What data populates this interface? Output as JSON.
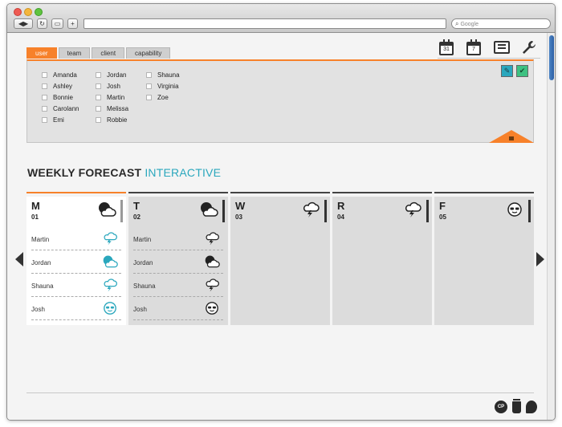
{
  "browser": {
    "search_placeholder": "Google",
    "buttons": [
      "◀",
      "▶",
      "↻",
      "+"
    ]
  },
  "top_icons": [
    {
      "name": "calendar-month-icon",
      "label": "31"
    },
    {
      "name": "calendar-week-icon",
      "label": "7"
    },
    {
      "name": "list-icon",
      "label": ""
    },
    {
      "name": "wrench-icon",
      "label": ""
    }
  ],
  "tabs": [
    {
      "label": "user",
      "active": true
    },
    {
      "label": "team",
      "active": false
    },
    {
      "label": "client",
      "active": false
    },
    {
      "label": "capability",
      "active": false
    }
  ],
  "users": {
    "column1": [
      "Amanda",
      "Ashley",
      "Bonnie",
      "Carolann",
      "Emi"
    ],
    "column2": [
      "Jordan",
      "Josh",
      "Martin",
      "Melissa",
      "Robbie"
    ],
    "column3": [
      "Shauna",
      "Virginia",
      "Zoe"
    ]
  },
  "heading": {
    "title": "WEEKLY FORECAST",
    "accent": "INTERACTIVE"
  },
  "colors": {
    "accent_orange": "#f7812a",
    "accent_teal": "#2aa7bd",
    "confirm_green": "#3ec181"
  },
  "days": [
    {
      "letter": "M",
      "num": "01",
      "icon": "partly-cloudy-icon",
      "active": true,
      "rows": [
        {
          "name": "Martin",
          "icon": "storm-icon"
        },
        {
          "name": "Jordan",
          "icon": "partly-cloudy-icon"
        },
        {
          "name": "Shauna",
          "icon": "storm-icon"
        },
        {
          "name": "Josh",
          "icon": "sunglasses-icon"
        }
      ]
    },
    {
      "letter": "T",
      "num": "02",
      "icon": "partly-cloudy-icon",
      "active": false,
      "rows": [
        {
          "name": "Martin",
          "icon": "storm-icon"
        },
        {
          "name": "Jordan",
          "icon": "partly-cloudy-icon"
        },
        {
          "name": "Shauna",
          "icon": "storm-icon"
        },
        {
          "name": "Josh",
          "icon": "sunglasses-icon"
        }
      ]
    },
    {
      "letter": "W",
      "num": "03",
      "icon": "storm-icon",
      "active": false,
      "rows": []
    },
    {
      "letter": "R",
      "num": "04",
      "icon": "storm-icon",
      "active": false,
      "rows": []
    },
    {
      "letter": "F",
      "num": "05",
      "icon": "sunglasses-icon",
      "active": false,
      "rows": []
    }
  ],
  "bottom_icons": [
    {
      "name": "cp-badge-icon",
      "label": "CP"
    },
    {
      "name": "trash-can-icon",
      "label": ""
    },
    {
      "name": "drop-icon",
      "label": ""
    }
  ]
}
